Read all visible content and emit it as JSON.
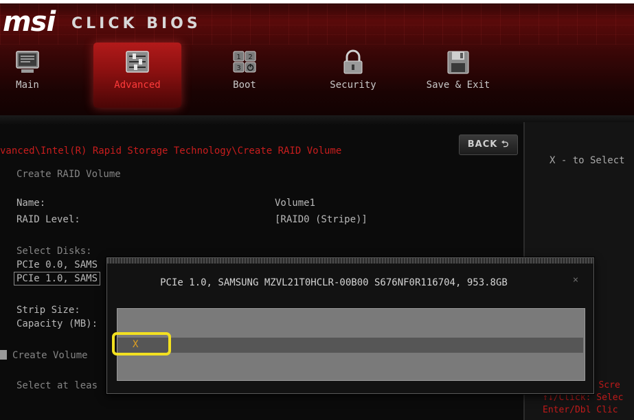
{
  "header": {
    "logo": "msi",
    "brand": "CLICK BIOS",
    "tabs": [
      {
        "label": "Main",
        "icon": "monitor-icon"
      },
      {
        "label": "Advanced",
        "icon": "sliders-icon",
        "active": true
      },
      {
        "label": "Boot",
        "icon": "boot-order-icon"
      },
      {
        "label": "Security",
        "icon": "lock-icon"
      },
      {
        "label": "Save & Exit",
        "icon": "floppy-disk-icon"
      }
    ]
  },
  "page": {
    "breadcrumb": "vanced\\Intel(R) Rapid Storage Technology\\Create RAID Volume",
    "back_label": "BACK",
    "heading": "Create RAID Volume",
    "name_label": "Name:",
    "name_value": "Volume1",
    "raid_label": "RAID Level:",
    "raid_value": "[RAID0 (Stripe)]",
    "select_disks": "Select Disks:",
    "disk1": "PCIe 0.0, SAMS",
    "disk2": "PCIe 1.0, SAMS",
    "strip_label": "Strip Size:",
    "capacity_label": "Capacity (MB):",
    "create_volume": "Create Volume",
    "select_hint": "Select at leas"
  },
  "dialog": {
    "title": "PCIe 1.0, SAMSUNG MZVL21T0HCLR-00B00 S676NF0R116704, 953.8GB",
    "option": "X",
    "close_label": "×"
  },
  "right": {
    "help": "X - to Select",
    "hint1": "ct Scre",
    "hint2": "↑↓/Click: Selec",
    "hint3": "Enter/Dbl Clic"
  },
  "colors": {
    "accent_red": "#c91d1d",
    "highlight": "#f2e021",
    "option_text": "#e0a020"
  }
}
